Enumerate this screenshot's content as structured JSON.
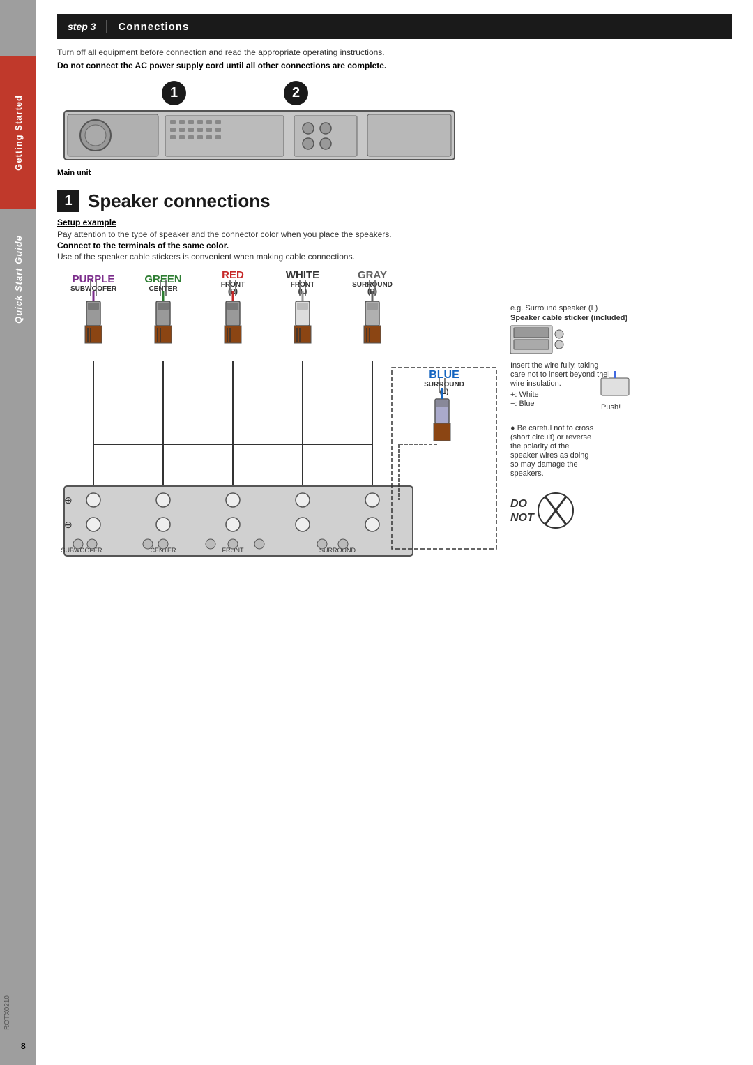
{
  "sidebar": {
    "getting_started": "Getting Started",
    "quick_start": "Quick Start Guide"
  },
  "step_header": {
    "step_num": "step 3",
    "divider": "|",
    "title": "Connections"
  },
  "instructions": {
    "line1": "Turn off all equipment before connection and read the appropriate operating instructions.",
    "line2": "Do not connect the AC power supply cord until all other connections are complete."
  },
  "section1": {
    "number": "1",
    "title": "Speaker connections"
  },
  "setup_example": {
    "title": "Setup example",
    "text1": "Pay attention to the type of speaker and the connector color when you place the speakers.",
    "text2_bold": "Connect to the terminals of the same color.",
    "text3": "Use of the speaker cable stickers is convenient when making cable connections."
  },
  "color_labels": [
    {
      "name": "PURPLE",
      "sub": "SUBWOOFER",
      "color": "purple"
    },
    {
      "name": "GREEN",
      "sub": "CENTER",
      "color": "green"
    },
    {
      "name": "RED",
      "sub1": "FRONT",
      "sub2": "(R)",
      "color": "red"
    },
    {
      "name": "WHITE",
      "sub1": "FRONT",
      "sub2": "(L)",
      "color": "white"
    },
    {
      "name": "GRAY",
      "sub1": "SURROUND",
      "sub2": "(R)",
      "color": "gray"
    }
  ],
  "blue_label": {
    "name": "BLUE",
    "sub1": "SURROUND",
    "sub2": "(L)"
  },
  "main_unit_label": "Main unit",
  "terminal_labels": [
    "SUBWOOFER",
    "CENTER",
    "FRONT",
    "SURROUND"
  ],
  "right_notes": {
    "example": "e.g. Surround speaker (L)",
    "sticker_note": "Speaker cable sticker (included)",
    "insert_note": "Insert the wire fully, taking\ncare not to insert beyond the\nwire insulation.",
    "plus_white": "+: White",
    "minus_blue": "−: Blue",
    "push": "Push!",
    "caution": "● Be careful not to cross\n(short circuit) or reverse\nthe polarity of the\nspeaker wires as doing\nso may damage the\nspeakers.",
    "do_not": "DO\nNOT"
  },
  "page_number": "8",
  "doc_code": "RQTX0210",
  "diagram_numbers": [
    "1",
    "2"
  ]
}
